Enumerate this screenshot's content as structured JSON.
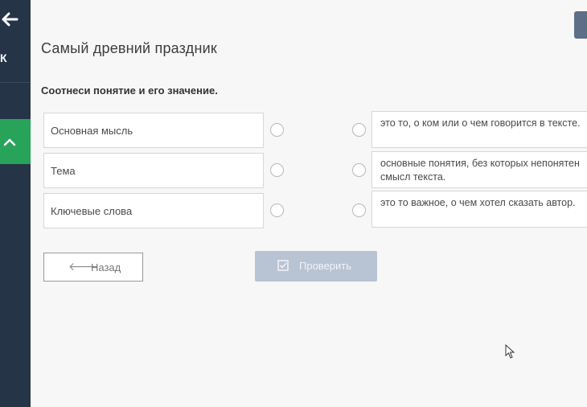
{
  "sidebar": {
    "letter": "К"
  },
  "lesson": {
    "title": "Самый древний праздник",
    "instruction": "Соотнеси понятие и его значение."
  },
  "terms": [
    {
      "label": "Основная мысль"
    },
    {
      "label": "Тема"
    },
    {
      "label": "Ключевые слова"
    }
  ],
  "definitions": [
    {
      "label": "это то, о ком или о чем говорится в тексте."
    },
    {
      "label": "основные понятия, без которых непонятен смысл текста."
    },
    {
      "label": "это то важное, о чем хотел сказать автор."
    }
  ],
  "buttons": {
    "back_label": "Назад",
    "check_label": "Проверить"
  },
  "colors": {
    "sidebar": "#253447",
    "active_item": "#27a35a",
    "check_button": "#b8c3d3"
  }
}
